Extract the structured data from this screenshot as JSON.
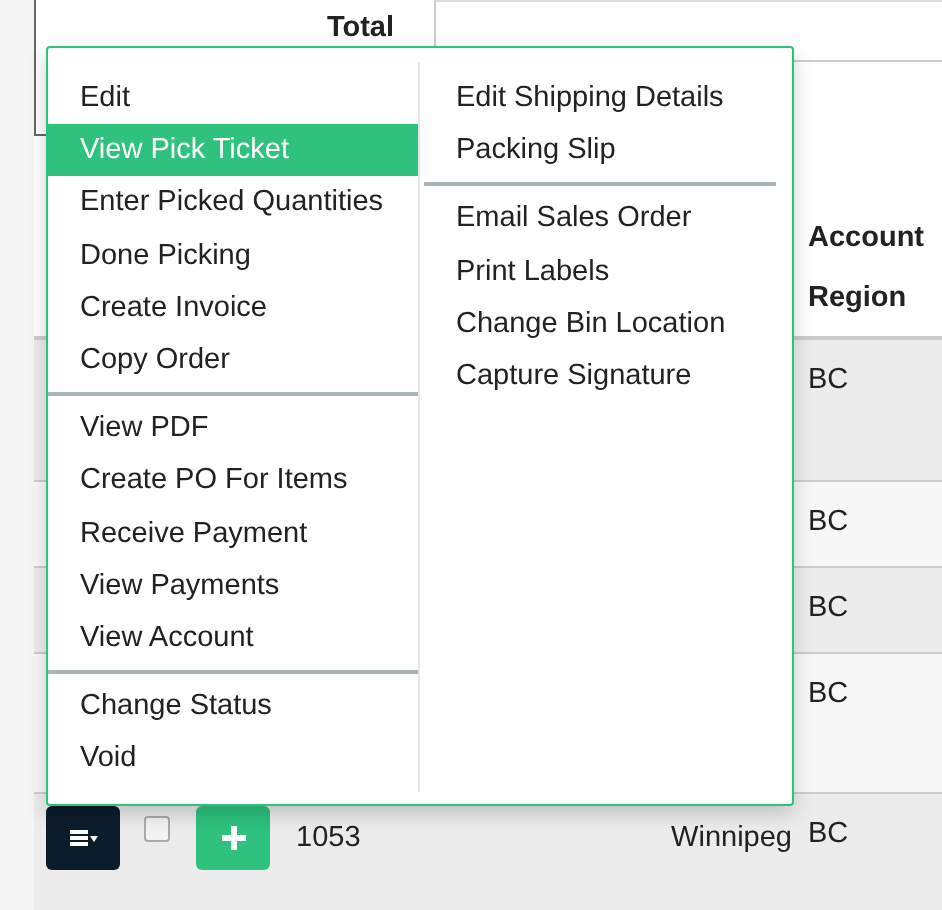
{
  "total_label": "Total",
  "table": {
    "columns": [
      "Account Region"
    ],
    "rows": [
      {
        "region": "BC"
      },
      {
        "region": "BC"
      },
      {
        "region": "BC"
      },
      {
        "region": "BC"
      },
      {
        "kind": "full",
        "number": "1053",
        "city": "Winnipeg",
        "region": "BC",
        "checked": false
      }
    ]
  },
  "menu": {
    "columns": [
      {
        "groups": [
          [
            {
              "label": "Edit",
              "selected": false
            },
            {
              "label": "View Pick Ticket",
              "selected": true
            },
            {
              "label": "Enter Picked Quantities",
              "selected": false
            },
            {
              "label": "Done Picking",
              "selected": false
            },
            {
              "label": "Create Invoice",
              "selected": false
            },
            {
              "label": "Copy Order",
              "selected": false
            }
          ],
          [
            {
              "label": "View PDF",
              "selected": false
            },
            {
              "label": "Create PO For Items",
              "selected": false
            },
            {
              "label": "Receive Payment",
              "selected": false
            },
            {
              "label": "View Payments",
              "selected": false
            },
            {
              "label": "View Account",
              "selected": false
            }
          ],
          [
            {
              "label": "Change Status",
              "selected": false
            },
            {
              "label": "Void",
              "selected": false
            }
          ]
        ]
      },
      {
        "groups": [
          [
            {
              "label": "Edit Shipping Details",
              "selected": false
            },
            {
              "label": "Packing Slip",
              "selected": false
            }
          ],
          [
            {
              "label": "Email Sales Order",
              "selected": false
            },
            {
              "label": "Print Labels",
              "selected": false
            },
            {
              "label": "Change Bin Location",
              "selected": false
            },
            {
              "label": "Capture Signature",
              "selected": false
            }
          ]
        ]
      }
    ]
  }
}
